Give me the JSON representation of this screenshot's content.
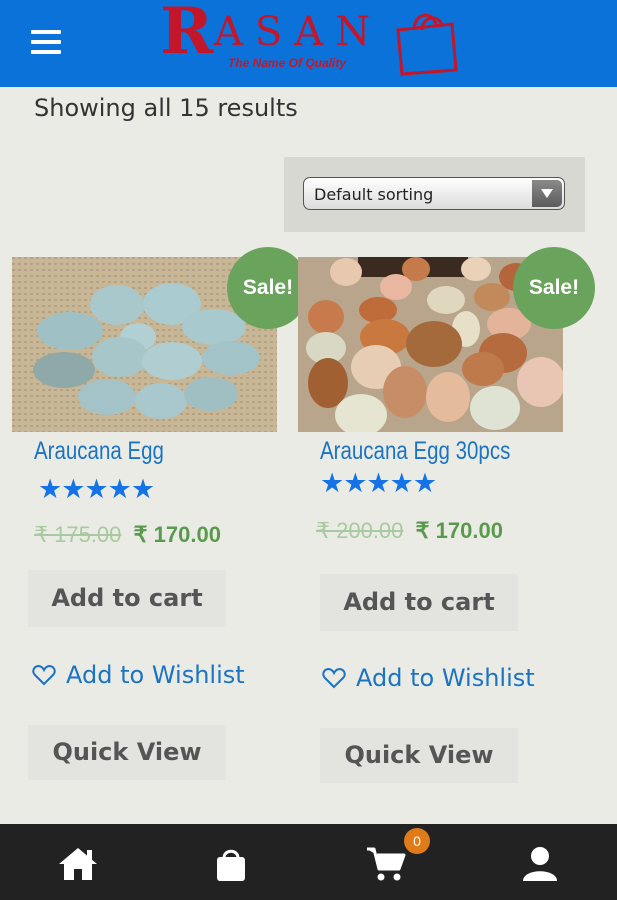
{
  "header": {
    "brand_main": "R",
    "brand_rest": "ASAN",
    "tagline": "The Name Of Quality"
  },
  "results_text": "Showing all 15 results",
  "sort": {
    "selected": "Default sorting"
  },
  "products": [
    {
      "badge": "Sale!",
      "title": "Araucana Egg",
      "stars": "★★★★★",
      "rating": 5,
      "old_price": "₹ 175.00",
      "price": "₹ 170.00",
      "add_to_cart": "Add to cart",
      "wishlist": "Add to Wishlist",
      "quick_view": "Quick View"
    },
    {
      "badge": "Sale!",
      "title": "Araucana Egg 30pcs",
      "stars": "★★★★★",
      "rating": 5,
      "old_price": "₹ 200.00",
      "price": "₹ 170.00",
      "add_to_cart": "Add to cart",
      "wishlist": "Add to Wishlist",
      "quick_view": "Quick View"
    }
  ],
  "bottom_nav": {
    "cart_count": "0"
  },
  "colors": {
    "header_bg": "#0a72d9",
    "brand_red": "#c4162a",
    "sale_green": "#6aa35c",
    "link_blue": "#1a73c4",
    "star_blue": "#1473e6",
    "price_green": "#5a9a4c",
    "badge_orange": "#e07b1a",
    "bottom_bar": "#222222"
  },
  "icons": [
    "menu-icon",
    "shopping-bag-icon",
    "heart-icon",
    "home-icon",
    "bag-icon",
    "cart-icon",
    "user-icon"
  ]
}
